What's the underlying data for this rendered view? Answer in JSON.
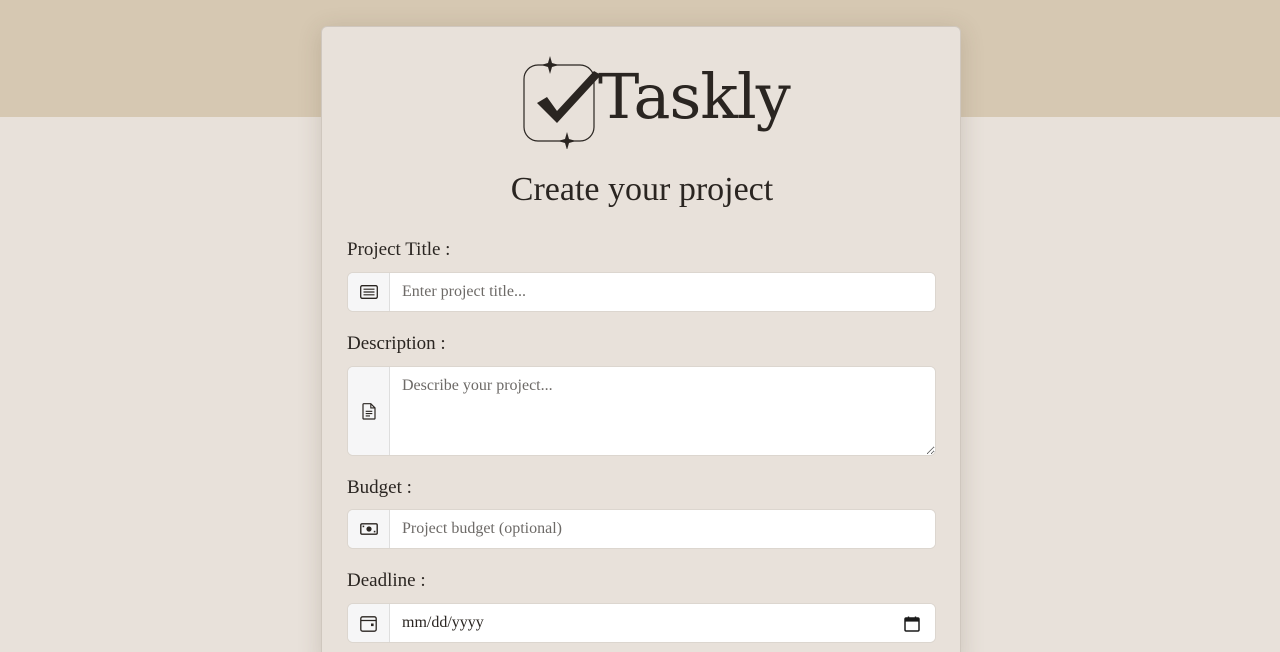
{
  "brand": {
    "name": "Taskly"
  },
  "form": {
    "title": "Create your project",
    "fields": {
      "title": {
        "label": "Project Title :",
        "placeholder": "Enter project title...",
        "icon": "text-lines-icon"
      },
      "description": {
        "label": "Description :",
        "placeholder": "Describe your project...",
        "icon": "document-icon"
      },
      "budget": {
        "label": "Budget :",
        "placeholder": "Project budget (optional)",
        "icon": "cash-icon"
      },
      "deadline": {
        "label": "Deadline :",
        "value_display": "mm/dd/yyyy",
        "icon": "calendar-icon",
        "picker_icon": "calendar-picker-icon"
      }
    }
  },
  "colors": {
    "page_background": "#e8e1da",
    "header_band": "#d6c8b2",
    "card_background": "#e8e1da",
    "addon_background": "#f6f6f7",
    "text": "#2a2521"
  }
}
